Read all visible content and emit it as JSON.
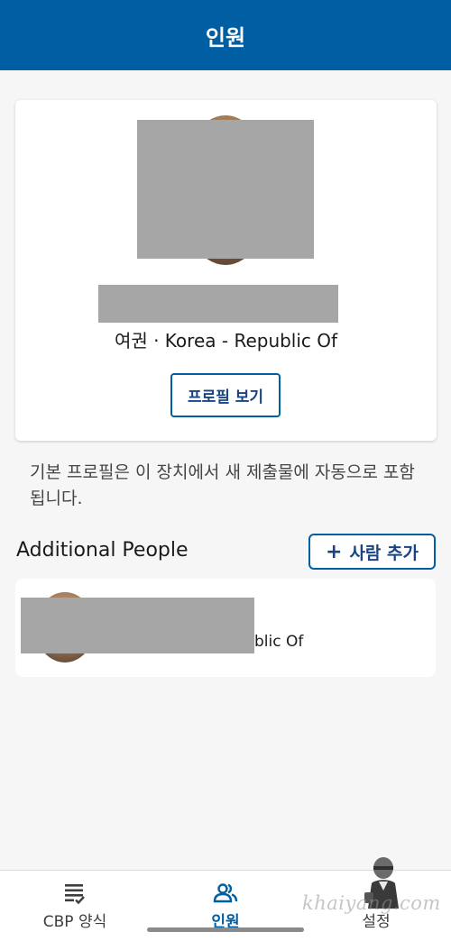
{
  "header": {
    "title": "인원"
  },
  "profile": {
    "document_info": "여권 · Korea - Republic Of",
    "view_button_label": "프로필 보기"
  },
  "note": "기본 프로필은 이 장치에서 새 제출물에 자동으로 포함됩니다.",
  "additional": {
    "title": "Additional People",
    "add_button_plus": "+",
    "add_button_label": "사람 추가",
    "people": [
      {
        "info": "blic Of"
      }
    ]
  },
  "nav": {
    "items": [
      {
        "label": "CBP 양식",
        "icon": "forms-list-icon"
      },
      {
        "label": "인원",
        "icon": "people-icon",
        "active": true
      },
      {
        "label": "설정",
        "icon": "settings-icon"
      }
    ]
  },
  "watermark": "khaiyang.com",
  "colors": {
    "primary": "#005ea2",
    "redaction": "#a6a6a6"
  }
}
